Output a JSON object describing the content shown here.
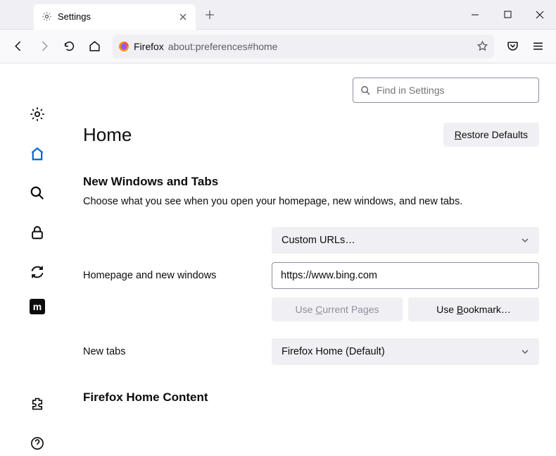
{
  "tab": {
    "title": "Settings"
  },
  "urlbar": {
    "prefix": "Firefox",
    "url": "about:preferences#home"
  },
  "search": {
    "placeholder": "Find in Settings"
  },
  "page": {
    "title": "Home"
  },
  "buttons": {
    "restore": "Restore Defaults",
    "restore_u": "R",
    "current_pages": "Use Current Pages",
    "current_pages_u": "C",
    "bookmark": "Use Bookmark…",
    "bookmark_u": "B"
  },
  "section1": {
    "title": "New Windows and Tabs",
    "desc": "Choose what you see when you open your homepage, new windows, and new tabs."
  },
  "fields": {
    "homepage_label": "Homepage and new windows",
    "homepage_select": "Custom URLs…",
    "homepage_value": "https://www.bing.com",
    "newtabs_label": "New tabs",
    "newtabs_select": "Firefox Home (Default)"
  },
  "section2": {
    "title": "Firefox Home Content"
  },
  "sidebar": {
    "m_label": "m"
  }
}
